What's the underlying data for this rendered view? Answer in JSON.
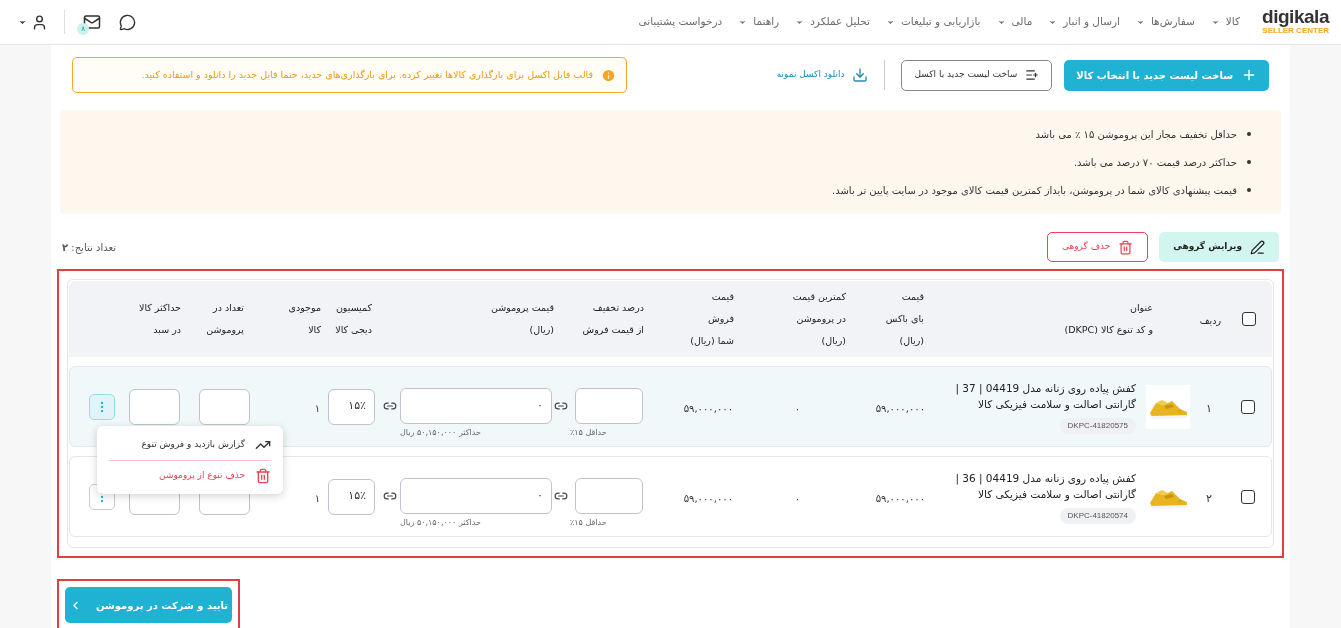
{
  "header": {
    "logo": "digikala",
    "logo_sub": "SELLER CENTER",
    "nav": [
      {
        "label": "کالا",
        "has_dropdown": true
      },
      {
        "label": "سفارش‌ها",
        "has_dropdown": true
      },
      {
        "label": "ارسال و انبار",
        "has_dropdown": true
      },
      {
        "label": "مالی",
        "has_dropdown": true
      },
      {
        "label": "بازاریابی و تبلیغات",
        "has_dropdown": true
      },
      {
        "label": "تحلیل عملکرد",
        "has_dropdown": true
      },
      {
        "label": "راهنما",
        "has_dropdown": true
      },
      {
        "label": "درخواست پشتیبانی",
        "has_dropdown": false
      }
    ],
    "mail_badge": "۸"
  },
  "toolbar": {
    "primary": "ساخت لیست جدید با انتخاب کالا",
    "excel": "ساخت لیست جدید با اکسل",
    "download": "دانلود اکسل نمونه",
    "alert": "قالب فایل اکسل برای بارگذاری کالاها تغییر کرده. برای بارگذاری‌های جدید، حتما فایل جدید را دانلود و استفاده کنید."
  },
  "notes": [
    "حداقل تخفیف مجاز این پروموشن ۱۵ ٪ می باشد",
    "حداکثر درصد قیمت ۷۰ درصد می باشد.",
    "قیمت پیشنهادی کالای شما در پروموشن، بایداز کمترین قیمت کالای موجود در سایت پایین تر باشد."
  ],
  "bulk": {
    "edit": "ویرایش گروهی",
    "delete": "حذف گروهی",
    "count": "تعداد نتایج: **۲**"
  },
  "table": {
    "select_all": false,
    "columns": [
      {
        "lines": [
          "ردیف"
        ]
      },
      {
        "lines": [
          "عنوان",
          "و کد تنوع کالا (DKPC)"
        ]
      },
      {
        "lines": [
          "قیمت",
          "بای باکس",
          "(ریال)"
        ]
      },
      {
        "lines": [
          "کمترین قیمت",
          "در پروموشن",
          "(ریال)"
        ]
      },
      {
        "lines": [
          "قیمت",
          "فروش",
          "شما (ریال)"
        ]
      },
      {
        "lines": [
          "درصد تخفیف",
          "از قیمت فروش"
        ]
      },
      {
        "lines": [
          "قیمت پروموشن",
          "(ریال)"
        ]
      },
      {
        "lines": [
          "کمیسیون",
          "دیجی کالا"
        ]
      },
      {
        "lines": [
          "موجودی",
          "کالا"
        ]
      },
      {
        "lines": [
          "تعداد در",
          "پروموشن"
        ]
      },
      {
        "lines": [
          "حداکثر کالا",
          "در سبد"
        ]
      }
    ],
    "rows": [
      {
        "checked": false,
        "index": "۱",
        "title": "کفش پیاده روی زنانه مدل 04419 | 37 | گارانتی اصالت و سلامت فیزیکی کالا",
        "dkpc": "DKPC-41820575",
        "box_price": "۵۹,۰۰۰,۰۰۰",
        "min_price": "۰",
        "sale_price": "۵۹,۰۰۰,۰۰۰",
        "discount_hint": "حداقل ۱۵٪",
        "promo_price": "۰",
        "promo_hint": "حداکثر ۵۰,۱۵۰,۰۰۰ ریال",
        "commission": "۱۵٪",
        "stock": "۱",
        "menu_open": true
      },
      {
        "checked": false,
        "index": "۲",
        "title": "کفش پیاده روی زنانه مدل 04419 | 36 | گارانتی اصالت و سلامت فیزیکی کالا",
        "dkpc": "DKPC-41820574",
        "box_price": "۵۹,۰۰۰,۰۰۰",
        "min_price": "۰",
        "sale_price": "۵۹,۰۰۰,۰۰۰",
        "discount_hint": "حداقل ۱۵٪",
        "promo_price": "۰",
        "promo_hint": "حداکثر ۵۰,۱۵۰,۰۰۰ ریال",
        "commission": "۱۵٪",
        "stock": "۱",
        "menu_open": false
      }
    ]
  },
  "row_menu": [
    {
      "label": "گزارش بازدید و فروش تنوع",
      "kind": "report"
    },
    {
      "label": "حذف تنوع از پروموشن",
      "kind": "delete"
    }
  ],
  "submit": "تایید و شرکت در پروموشن"
}
